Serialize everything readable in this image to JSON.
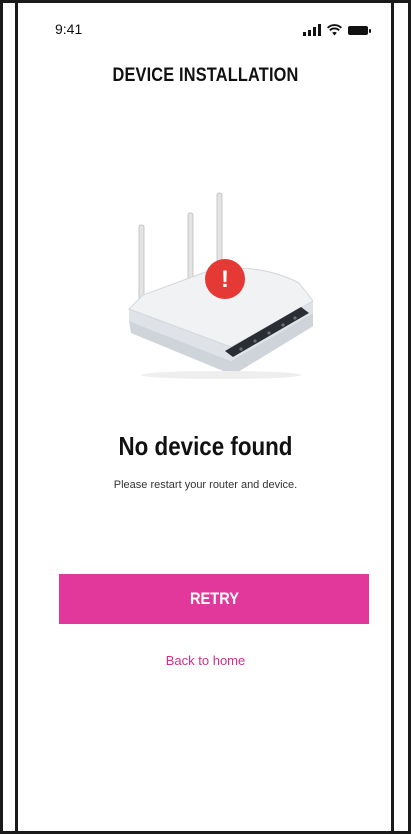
{
  "status_bar": {
    "time": "9:41",
    "signal_icon": "cellular-signal-icon",
    "wifi_icon": "wifi-icon",
    "battery_icon": "battery-icon"
  },
  "header": {
    "title": "DEVICE INSTALLATION"
  },
  "illustration": {
    "icon": "router-error-icon",
    "badge_icon": "exclamation-icon",
    "badge_text": "!"
  },
  "message": {
    "headline": "No device found",
    "subtext": "Please restart your router and device."
  },
  "actions": {
    "retry_label": "RETRY",
    "back_label": "Back to home"
  },
  "colors": {
    "accent": "#e2379b",
    "link": "#d0308c",
    "error": "#e53935"
  }
}
